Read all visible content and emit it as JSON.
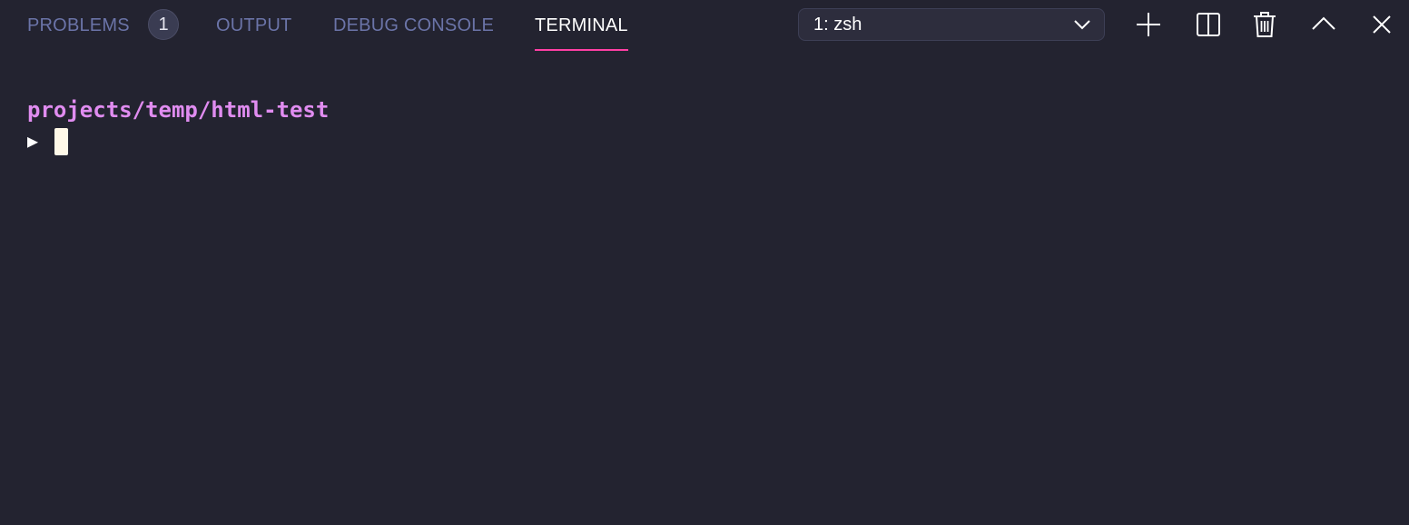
{
  "tabs": [
    {
      "label": "PROBLEMS",
      "badge": "1"
    },
    {
      "label": "OUTPUT"
    },
    {
      "label": "DEBUG CONSOLE"
    },
    {
      "label": "TERMINAL",
      "active": true
    }
  ],
  "terminal_select": {
    "selected": "1: zsh"
  },
  "actions": {
    "new_terminal": "plus-icon",
    "split_terminal": "split-icon",
    "kill_terminal": "trash-icon",
    "maximize_panel": "chevron-up-icon",
    "close_panel": "close-icon"
  },
  "terminal": {
    "cwd": "projects/temp/html-test",
    "prompt_symbol": "▶"
  },
  "colors": {
    "background": "#232330",
    "tab_inactive": "#6b74a8",
    "tab_active": "#ffffff",
    "active_underline": "#ff3fa4",
    "cwd": "#e08cf0",
    "cursor": "#fff9e8"
  }
}
